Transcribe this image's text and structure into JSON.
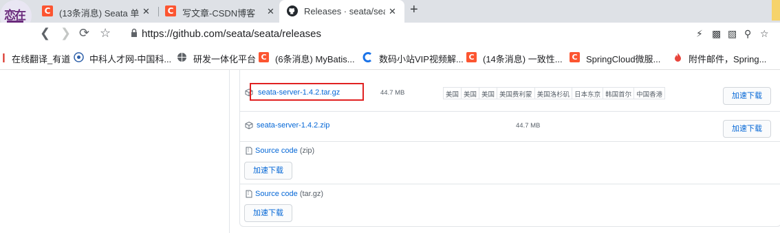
{
  "browser": {
    "tabs": [
      {
        "title": "(13条消息) Seata 单",
        "icon": "csdn-icon",
        "active": false
      },
      {
        "title": "写文章-CSDN博客",
        "icon": "csdn-icon",
        "active": false
      },
      {
        "title": "Releases · seata/sea",
        "icon": "github-icon",
        "active": true
      }
    ],
    "close_glyph": "✕",
    "new_tab_glyph": "+",
    "url": "https://github.com/seata/seata/releases",
    "bookmarks": [
      {
        "label": "在线翻译_有道",
        "icon": "youdao-icon"
      },
      {
        "label": "中科人才网-中国科...",
        "icon": "talent-icon"
      },
      {
        "label": "研发一体化平台",
        "icon": "globe-icon"
      },
      {
        "label": "(6条消息) MyBatis...",
        "icon": "csdn-icon"
      },
      {
        "label": "数码小站VIP视频解...",
        "icon": "video-icon"
      },
      {
        "label": "(14条消息) 一致性...",
        "icon": "csdn-icon"
      },
      {
        "label": "SpringCloud微服...",
        "icon": "csdn-icon"
      },
      {
        "label": "附件邮件，Spring...",
        "icon": "fire-icon"
      }
    ]
  },
  "assets": {
    "items": [
      {
        "name": "seata-server-1.4.2.tar.gz",
        "size": "44.7 MB",
        "mirrors": [
          "美国",
          "美国",
          "美国",
          "美国费利蒙",
          "美国洛杉矶",
          "日本东京",
          "韩国首尔",
          "中国香港"
        ],
        "download_label": "加速下载"
      },
      {
        "name": "seata-server-1.4.2.zip",
        "size": "44.7 MB",
        "download_label": "加速下载"
      }
    ],
    "source_zip": {
      "label": "Source code",
      "ext": "(zip)",
      "download_label": "加速下载"
    },
    "source_tar": {
      "label": "Source code",
      "ext": "(tar.gz)",
      "download_label": "加速下载"
    }
  },
  "colors": {
    "link": "#0366d6",
    "highlight": "#e02020",
    "csdn": "#fc5531"
  }
}
